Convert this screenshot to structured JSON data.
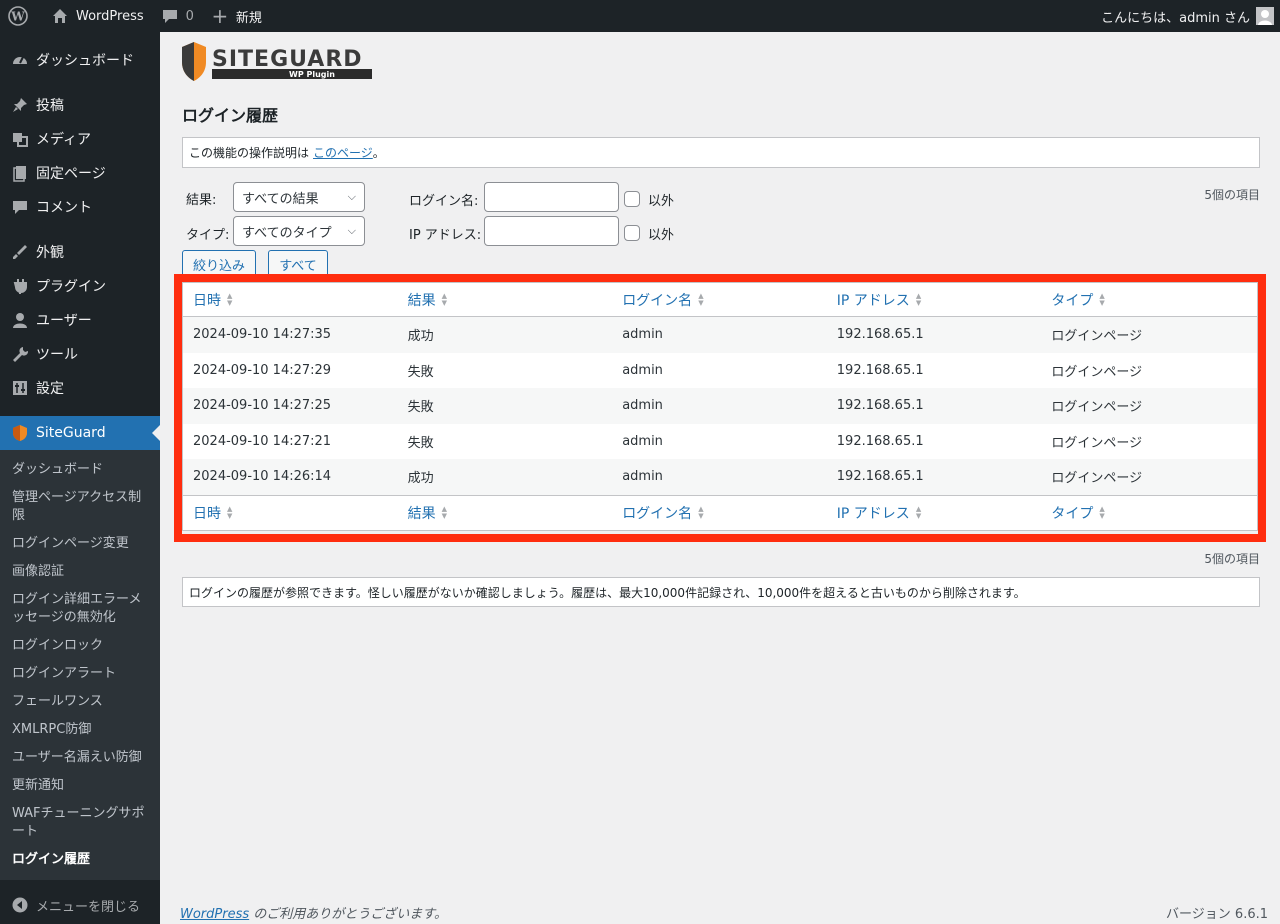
{
  "adminbar": {
    "site_name": "WordPress",
    "comments_count": "0",
    "new_label": "新規",
    "greeting": "こんにちは、admin さん"
  },
  "sidebar": {
    "items": [
      {
        "label": "ダッシュボード",
        "icon": "dashboard-icon"
      },
      {
        "label": "投稿",
        "icon": "pin-icon"
      },
      {
        "label": "メディア",
        "icon": "media-icon"
      },
      {
        "label": "固定ページ",
        "icon": "page-icon"
      },
      {
        "label": "コメント",
        "icon": "comment-icon"
      },
      {
        "label": "外観",
        "icon": "brush-icon"
      },
      {
        "label": "プラグイン",
        "icon": "plugin-icon"
      },
      {
        "label": "ユーザー",
        "icon": "user-icon"
      },
      {
        "label": "ツール",
        "icon": "wrench-icon"
      },
      {
        "label": "設定",
        "icon": "settings-icon"
      },
      {
        "label": "SiteGuard",
        "icon": "siteguard-icon"
      }
    ],
    "submenu": [
      "ダッシュボード",
      "管理ページアクセス制限",
      "ログインページ変更",
      "画像認証",
      "ログイン詳細エラーメッセージの無効化",
      "ログインロック",
      "ログインアラート",
      "フェールワンス",
      "XMLRPC防御",
      "ユーザー名漏えい防御",
      "更新通知",
      "WAFチューニングサポート",
      "ログイン履歴"
    ],
    "collapse_label": "メニューを閉じる"
  },
  "logo": {
    "main": "SITEGUARD",
    "sub": "WP Plugin"
  },
  "page_title": "ログイン履歴",
  "notice": {
    "prefix": "この機能の操作説明は ",
    "link": "このページ",
    "suffix": "。"
  },
  "filters": {
    "result_label": "結果:",
    "result_value": "すべての結果",
    "type_label": "タイプ:",
    "type_value": "すべてのタイプ",
    "login_label": "ログイン名:",
    "ip_label": "IP アドレス:",
    "exclude_label": "以外",
    "filter_button": "絞り込み",
    "all_button": "すべて",
    "items_count": "5個の項目"
  },
  "table": {
    "columns": [
      "日時",
      "結果",
      "ログイン名",
      "IP アドレス",
      "タイプ"
    ],
    "rows": [
      [
        "2024-09-10 14:27:35",
        "成功",
        "admin",
        "192.168.65.1",
        "ログインページ"
      ],
      [
        "2024-09-10 14:27:29",
        "失敗",
        "admin",
        "192.168.65.1",
        "ログインページ"
      ],
      [
        "2024-09-10 14:27:25",
        "失敗",
        "admin",
        "192.168.65.1",
        "ログインページ"
      ],
      [
        "2024-09-10 14:27:21",
        "失敗",
        "admin",
        "192.168.65.1",
        "ログインページ"
      ],
      [
        "2024-09-10 14:26:14",
        "成功",
        "admin",
        "192.168.65.1",
        "ログインページ"
      ]
    ]
  },
  "info_notice": "ログインの履歴が参照できます。怪しい履歴がないか確認しましょう。履歴は、最大10,000件記録され、10,000件を超えると古いものから削除されます。",
  "footer": {
    "link": "WordPress",
    "thanks": " のご利用ありがとうございます。",
    "version": "バージョン 6.6.1"
  },
  "colors": {
    "accent": "#2271b1",
    "highlight": "#ff2d0f",
    "sidebar": "#1d2327"
  }
}
